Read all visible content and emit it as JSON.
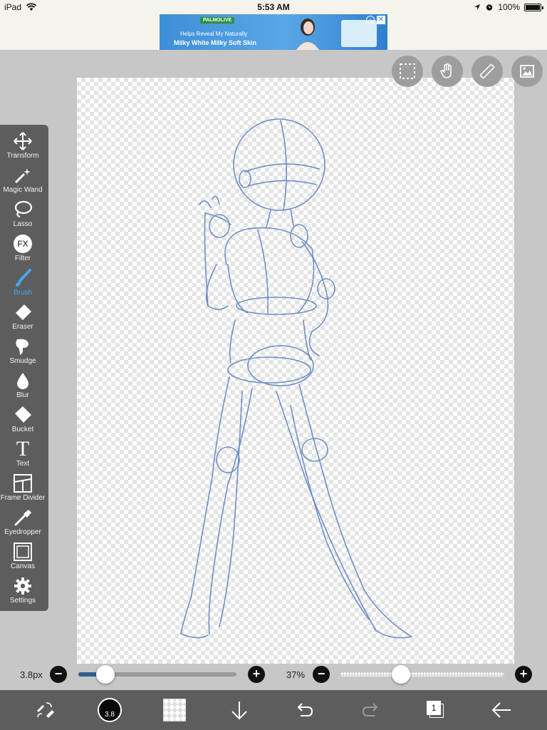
{
  "status_bar": {
    "device": "iPad",
    "time": "5:53 AM",
    "battery": "100%"
  },
  "ad": {
    "brand": "PALMOLIVE",
    "line1": "Helps Reveal My Naturally",
    "line2": "Milky White Milky Soft Skin",
    "info": "i",
    "close": "✕"
  },
  "toolbar": {
    "items": [
      {
        "label": "Transform",
        "icon": "move-arrows-icon"
      },
      {
        "label": "Magic Wand",
        "icon": "magic-wand-icon"
      },
      {
        "label": "Lasso",
        "icon": "lasso-icon"
      },
      {
        "label": "Filter",
        "icon": "fx-icon"
      },
      {
        "label": "Brush",
        "icon": "brush-icon",
        "active": true
      },
      {
        "label": "Eraser",
        "icon": "eraser-icon"
      },
      {
        "label": "Smudge",
        "icon": "smudge-icon"
      },
      {
        "label": "Blur",
        "icon": "droplet-icon"
      },
      {
        "label": "Bucket",
        "icon": "bucket-icon"
      },
      {
        "label": "Text",
        "icon": "text-icon"
      },
      {
        "label": "Frame Divider",
        "icon": "frame-divider-icon"
      },
      {
        "label": "Eyedropper",
        "icon": "eyedropper-icon"
      },
      {
        "label": "Canvas",
        "icon": "canvas-icon"
      },
      {
        "label": "Settings",
        "icon": "gear-icon"
      }
    ],
    "filter_glyph": "FX",
    "text_glyph": "T"
  },
  "brush": {
    "size_label": "3.8px",
    "size_fraction": 0.17,
    "opacity_label": "37%",
    "opacity_fraction": 0.37,
    "minus": "−",
    "plus": "+"
  },
  "bottom_bar": {
    "color_label": "3.8",
    "layer_count": "1"
  },
  "colors": {
    "accent": "#4aa6f0",
    "sketch_line": "#6f8fc6",
    "toolbar_bg": "#5d5d5d"
  }
}
